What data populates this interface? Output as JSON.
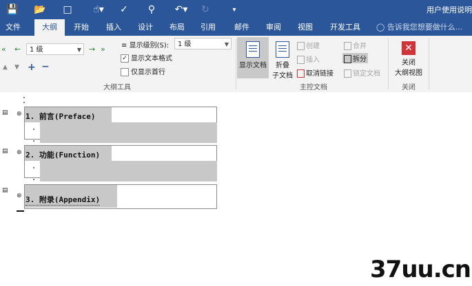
{
  "title_bar": {
    "title": "用户使用说明"
  },
  "quick_access": {
    "icons": [
      "save-icon",
      "folder-icon",
      "new-document-icon",
      "touch-mode-icon",
      "spellcheck-icon",
      "print-preview-icon",
      "undo-icon",
      "redo-icon",
      "customize-icon"
    ]
  },
  "tabs": [
    {
      "label": "文件"
    },
    {
      "label": "大纲"
    },
    {
      "label": "开始"
    },
    {
      "label": "插入"
    },
    {
      "label": "设计"
    },
    {
      "label": "布局"
    },
    {
      "label": "引用"
    },
    {
      "label": "邮件"
    },
    {
      "label": "审阅"
    },
    {
      "label": "视图"
    },
    {
      "label": "开发工具"
    }
  ],
  "tell_me": {
    "placeholder": "告诉我您想要做什么..."
  },
  "outline_tools": {
    "level_value": "1 级",
    "show_level_label": "显示级别(S):",
    "show_level_value": "1 级",
    "show_text_format_label": "显示文本格式",
    "show_text_format_checked": true,
    "first_line_only_label": "仅显示首行",
    "first_line_only_checked": false,
    "group_label": "大纲工具"
  },
  "master_document": {
    "show_document_label": "显示文档",
    "collapse_label_1": "折叠",
    "collapse_label_2": "子文档",
    "create_label": "创建",
    "insert_label": "插入",
    "unlink_label": "取消链接",
    "merge_label": "合并",
    "split_label": "拆分",
    "lock_label": "锁定文档",
    "group_label": "主控文档"
  },
  "close_group": {
    "close_label_1": "关闭",
    "close_label_2": "大纲视图",
    "group_label": "关闭"
  },
  "document": {
    "headings": [
      {
        "text": "1. 前言(Preface)"
      },
      {
        "text": "2. 功能(Function)"
      },
      {
        "text": "3. 附录(Appendix)"
      }
    ]
  },
  "watermark": {
    "text": "37uu.cn"
  },
  "colors": {
    "accent": "#2b579a",
    "ribbon_bg": "#f3f3f3",
    "highlight": "#c8c8c8",
    "close_red": "#d13438"
  }
}
